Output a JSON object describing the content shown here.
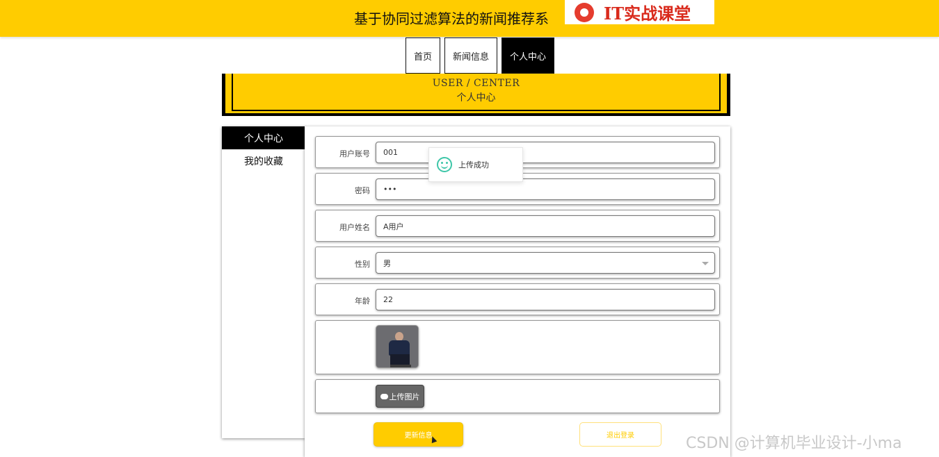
{
  "header": {
    "site_title": "基于协同过滤算法的新闻推荐系",
    "logo_text": "IT实战课堂",
    "accent_color": "#ffcc00"
  },
  "nav": [
    {
      "label": "首页"
    },
    {
      "label": "新闻信息"
    },
    {
      "label": "个人中心",
      "active": true
    }
  ],
  "banner": {
    "en": "USER / CENTER",
    "cn": "个人中心"
  },
  "sidebar": {
    "items": [
      {
        "label": "个人中心",
        "active": true
      },
      {
        "label": "我的收藏"
      }
    ]
  },
  "form": {
    "account": {
      "label": "用户账号",
      "value": "001"
    },
    "password": {
      "label": "密码",
      "value": "•••"
    },
    "name": {
      "label": "用户姓名",
      "value": "A用户"
    },
    "gender": {
      "label": "性别",
      "value": "男"
    },
    "age": {
      "label": "年龄",
      "value": "22"
    },
    "upload_label": "上传图片",
    "update_button": "更新信息",
    "logout_button": "退出登录"
  },
  "toast": {
    "text": "上传成功"
  },
  "watermark": "CSDN @计算机毕业设计-小ma"
}
